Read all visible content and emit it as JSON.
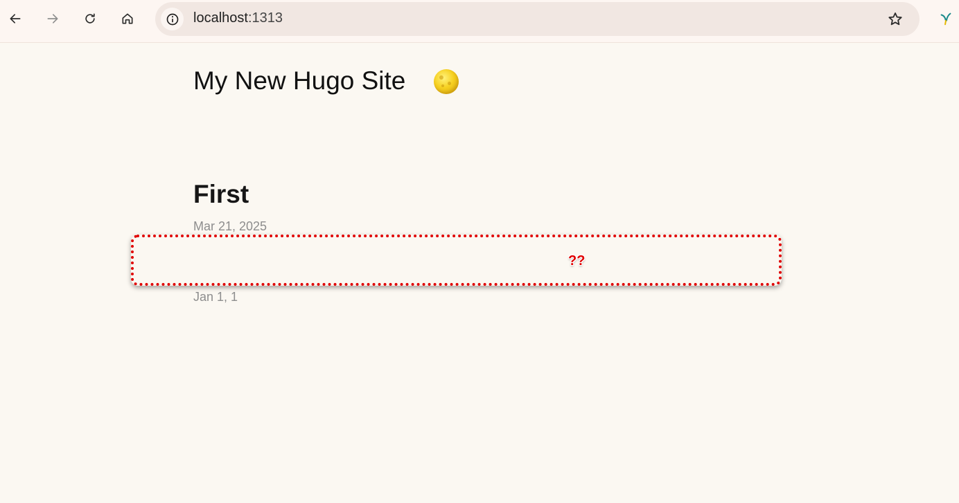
{
  "browser": {
    "url_host": "localhost",
    "url_port": ":1313",
    "icons": {
      "back": "arrow-left-icon",
      "forward": "arrow-right-icon",
      "reload": "reload-icon",
      "home": "home-icon",
      "site_info": "info-icon",
      "bookmark": "star-icon",
      "extension": "extension-icon"
    }
  },
  "site": {
    "title": "My New Hugo Site",
    "theme_toggle_icon": "moon-icon"
  },
  "posts": [
    {
      "title": "First",
      "date": "Mar 21, 2025"
    },
    {
      "title": "",
      "date": "Jan 1, 1"
    }
  ],
  "annotation": {
    "label": "??",
    "color": "#e00000"
  }
}
